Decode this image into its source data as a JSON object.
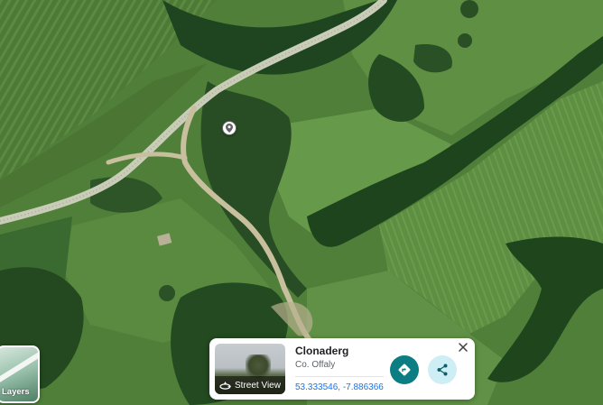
{
  "map": {
    "view": "satellite"
  },
  "layers": {
    "label": "Layers"
  },
  "place_card": {
    "name": "Clonaderg",
    "region": "Co. Offaly",
    "coordinates": "53.333546, -7.886366",
    "street_view_label": "Street View",
    "accent_color": "#0b7d83"
  },
  "icons": {
    "marker": "place-pin-icon",
    "close": "close-icon",
    "directions": "directions-icon",
    "share": "share-icon",
    "street_view": "street-view-icon"
  }
}
